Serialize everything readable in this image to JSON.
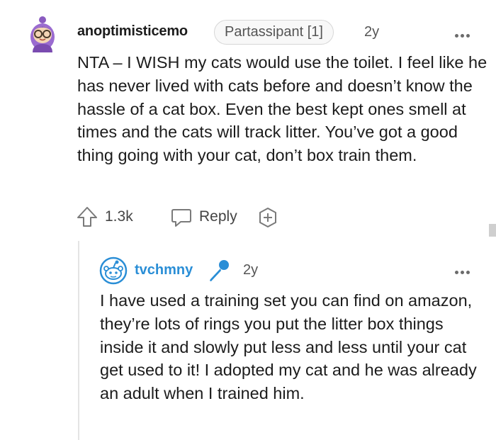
{
  "comment": {
    "username": "anoptimisticemo",
    "flair": "Partassipant [1]",
    "age": "2y",
    "body": "NTA – I WISH my cats would use the toilet. I feel like he has never lived with cats before and doesn’t know the hassle of a cat box. Even the best kept ones smell at times and the cats will track litter. You’ve got a good thing going with your cat, don’t box train them.",
    "votes": "1.3k",
    "reply_label": "Reply",
    "avatar_icon": "snoo-avatar-glasses-purple-hair",
    "more_icon": "more-options-icon"
  },
  "reply": {
    "username": "tvchmny",
    "username_color": "#2a8ed6",
    "badge_icon": "microphone-icon",
    "age": "2y",
    "body": "I have used a training set you can find on amazon, they’re lots of rings you put the litter box things inside it and slowly put less and less until your cat get used to it! I adopted my cat and he was already an adult when I trained him.",
    "avatar_icon": "snoo-default-avatar",
    "more_icon": "more-options-icon"
  },
  "colors": {
    "text": "#1c1c1c",
    "meta": "#555555",
    "accent": "#2a8ed6"
  }
}
